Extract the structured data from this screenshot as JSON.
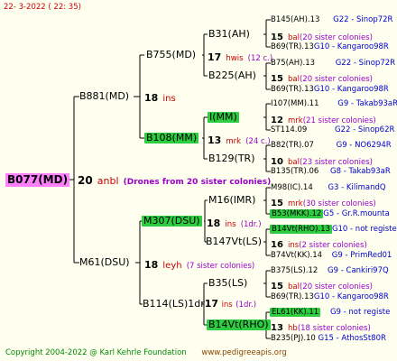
{
  "header": {
    "date": "22-  3-2022 ( 22: 35)"
  },
  "footer": {
    "copyright": "Copyright 2004-2022 @ Karl Kehrle Foundation",
    "site": "www.pedigreeapis.org"
  },
  "colors": {
    "queen_highlight": "#2ecc40",
    "root_highlight": "#ff7fff",
    "background": "#fffff0"
  },
  "root": {
    "name": "B077(MD)"
  },
  "gen1": {
    "age": "20",
    "type": "anbl",
    "note": "(Drones from 20 sister colonies)",
    "father": {
      "name": "B881(MD)"
    },
    "mother": {
      "name": "M61(DSU)",
      "age": "18",
      "type": "leyh",
      "note": "(7 sister colonies)"
    }
  },
  "gen2": {
    "b881": {
      "age": "18",
      "type": "ins"
    },
    "b755": {
      "name": "B755(MD)",
      "age": "17",
      "type": "hwis",
      "note": "(12 c.)"
    },
    "b108": {
      "name": "B108(MM)",
      "age": "13",
      "type": "mrk",
      "note": "(24 c.)"
    },
    "m307": {
      "name": "M307(DSU)",
      "age": "18",
      "type": "ins",
      "note": "(1dr.)"
    },
    "b114": {
      "name": "B114(LS)1dr",
      "age": "17",
      "type": "ins",
      "note": "(1dr.)"
    }
  },
  "gen3": {
    "b31": {
      "name": "B31(AH)",
      "age": "15",
      "type": "bal",
      "note": "(20 sister colonies)"
    },
    "b225": {
      "name": "B225(AH)",
      "age": "15",
      "type": "bal",
      "note": "(20 sister colonies)"
    },
    "i1": {
      "name": "I(MM)",
      "age": "12",
      "type": "mrk",
      "note": "(21 sister colonies)"
    },
    "b129": {
      "name": "B129(TR)",
      "age": "10",
      "type": "bal",
      "note": "(23 sister colonies)"
    },
    "m16": {
      "name": "M16(IMR)",
      "age": "15",
      "type": "mrk",
      "note": "(30 sister colonies)"
    },
    "b147": {
      "name": "B147Vt(LS)",
      "age": "16",
      "type": "ins",
      "note": "(2 sister colonies)"
    },
    "b35": {
      "name": "B35(LS)",
      "age": "15",
      "type": "bal",
      "note": "(20 sister colonies)"
    },
    "b14": {
      "name": "B14Vt(RHO)",
      "age": "13",
      "type": "hb",
      "note": "(18 sister colonies)"
    }
  },
  "gen4": [
    {
      "name": "B145(AH).13",
      "ref": "G22 - Sinop72R"
    },
    {
      "name": "B69(TR).13",
      "ref": "G10 - Kangaroo98R"
    },
    {
      "name": "B75(AH).13",
      "ref": "G22 - Sinop72R"
    },
    {
      "name": "B69(TR).13",
      "ref": "G10 - Kangaroo98R"
    },
    {
      "name": "I107(MM).11",
      "ref": "G9 - Takab93aR"
    },
    {
      "name": "ST114.09",
      "ref": "G22 - Sinop62R"
    },
    {
      "name": "B82(TR).07",
      "ref": "G9 - NO6294R"
    },
    {
      "name": "B135(TR).06",
      "ref": "G8 - Takab93aR"
    },
    {
      "name": "M98(IC).14",
      "ref": "G3 - KilimandQ"
    },
    {
      "name": "B53(MKK).12",
      "ref": "G5 - Gr.R.mounta"
    },
    {
      "name": "B14Vt(RHO).13",
      "ref": "G10 - not registe"
    },
    {
      "name": "B74Vt(KK).14",
      "ref": "G9 - PrimRed01"
    },
    {
      "name": "B375(LS).12",
      "ref": "G9 - Cankiri97Q"
    },
    {
      "name": "B69(TR).13",
      "ref": "G10 - Kangaroo98R"
    },
    {
      "name": "EL61(KK).11",
      "ref": "G9 - not registe"
    },
    {
      "name": "B235(PJ).10",
      "ref": "G15 - AthosSt80R"
    }
  ]
}
